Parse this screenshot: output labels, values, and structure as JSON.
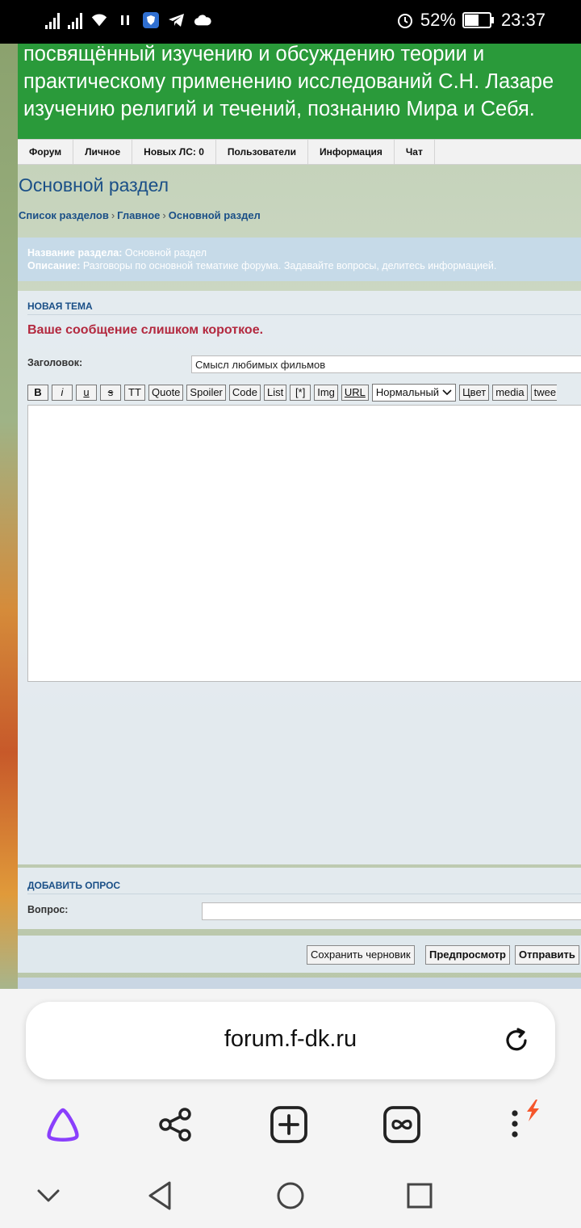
{
  "status_bar": {
    "battery_percent": "52%",
    "battery_level": 0.52,
    "time": "23:37",
    "icons": [
      "signal-icon",
      "signal-icon",
      "wifi-icon",
      "pause-icon",
      "shield-app-icon",
      "telegram-icon",
      "cloud-icon",
      "alarm-icon",
      "battery-icon"
    ]
  },
  "banner": {
    "lines": [
      "посвящённый изучению и обсуждению теории и",
      "практическому применению исследований С.Н. Лазаре",
      "изучению религий и течений, познанию Мира и Себя."
    ]
  },
  "nav": {
    "items": [
      "Форум",
      "Личное",
      "Новых ЛС: 0",
      "Пользователи",
      "Информация",
      "Чат"
    ]
  },
  "page": {
    "title": "Основной раздел",
    "breadcrumb": [
      "Список разделов",
      "Главное",
      "Основной раздел"
    ],
    "breadcrumb_sep": "›"
  },
  "forum_info": {
    "name_label": "Название раздела:",
    "name_value": "Основной раздел",
    "desc_label": "Описание:",
    "desc_value": "Разговоры по основной тематике форума. Задавайте вопросы, делитесь информацией."
  },
  "new_topic": {
    "heading": "НОВАЯ ТЕМА",
    "error": "Ваше сообщение слишком короткое.",
    "subject_label": "Заголовок:",
    "subject_value": "Смысл любимых фильмов",
    "toolbar": [
      "B",
      "i",
      "u",
      "s",
      "TT",
      "Quote",
      "Spoiler",
      "Code",
      "List",
      "[*]",
      "Img",
      "URL"
    ],
    "size_select": "Нормальный",
    "toolbar_after": [
      "Цвет",
      "media",
      "twee"
    ]
  },
  "poll": {
    "heading": "ДОБАВИТЬ ОПРОС",
    "question_label": "Вопрос:"
  },
  "actions": {
    "save_draft": "Сохранить черновик",
    "preview": "Предпросмотр",
    "submit": "Отправить"
  },
  "browser": {
    "url": "forum.f-dk.ru",
    "accent": "#8a3ffc",
    "bolt_color": "#f5562b"
  }
}
